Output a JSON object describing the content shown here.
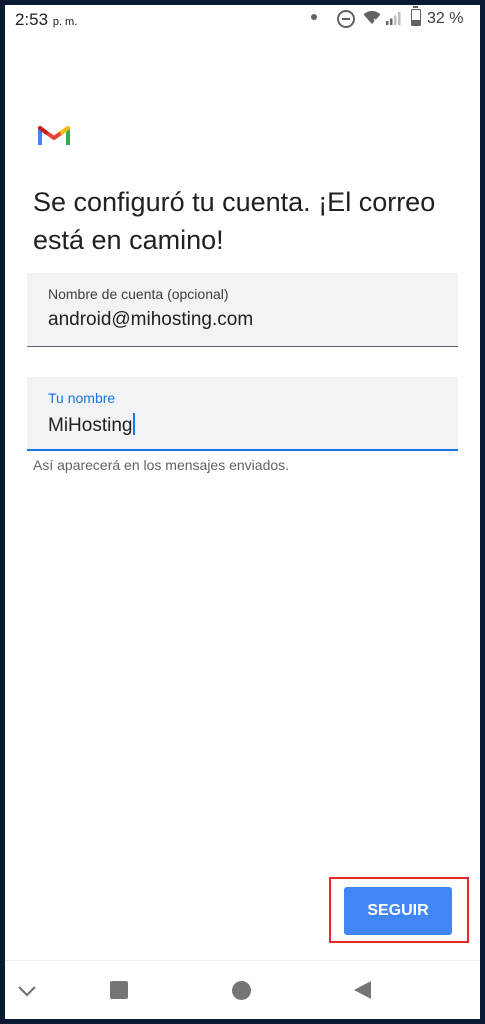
{
  "status_bar": {
    "time": "2:53",
    "ampm": "p. m.",
    "battery": "32 %"
  },
  "title": "Se configuró tu cuenta. ¡El correo está en camino!",
  "account_field": {
    "label": "Nombre de cuenta (opcional)",
    "value": "android@mihosting.com"
  },
  "name_field": {
    "label": "Tu nombre",
    "value": "MiHosting"
  },
  "helper_text": "Así aparecerá en los mensajes enviados.",
  "next_button": {
    "label": "SEGUIR"
  },
  "colors": {
    "accent": "#1a73e8",
    "button": "#4285f4",
    "highlight": "#e8272d"
  },
  "icons": [
    "gmail-logo",
    "dnd-icon",
    "wifi-icon",
    "signal-icon",
    "battery-icon",
    "nav-down-icon",
    "nav-recents-icon",
    "nav-home-icon",
    "nav-back-icon"
  ]
}
